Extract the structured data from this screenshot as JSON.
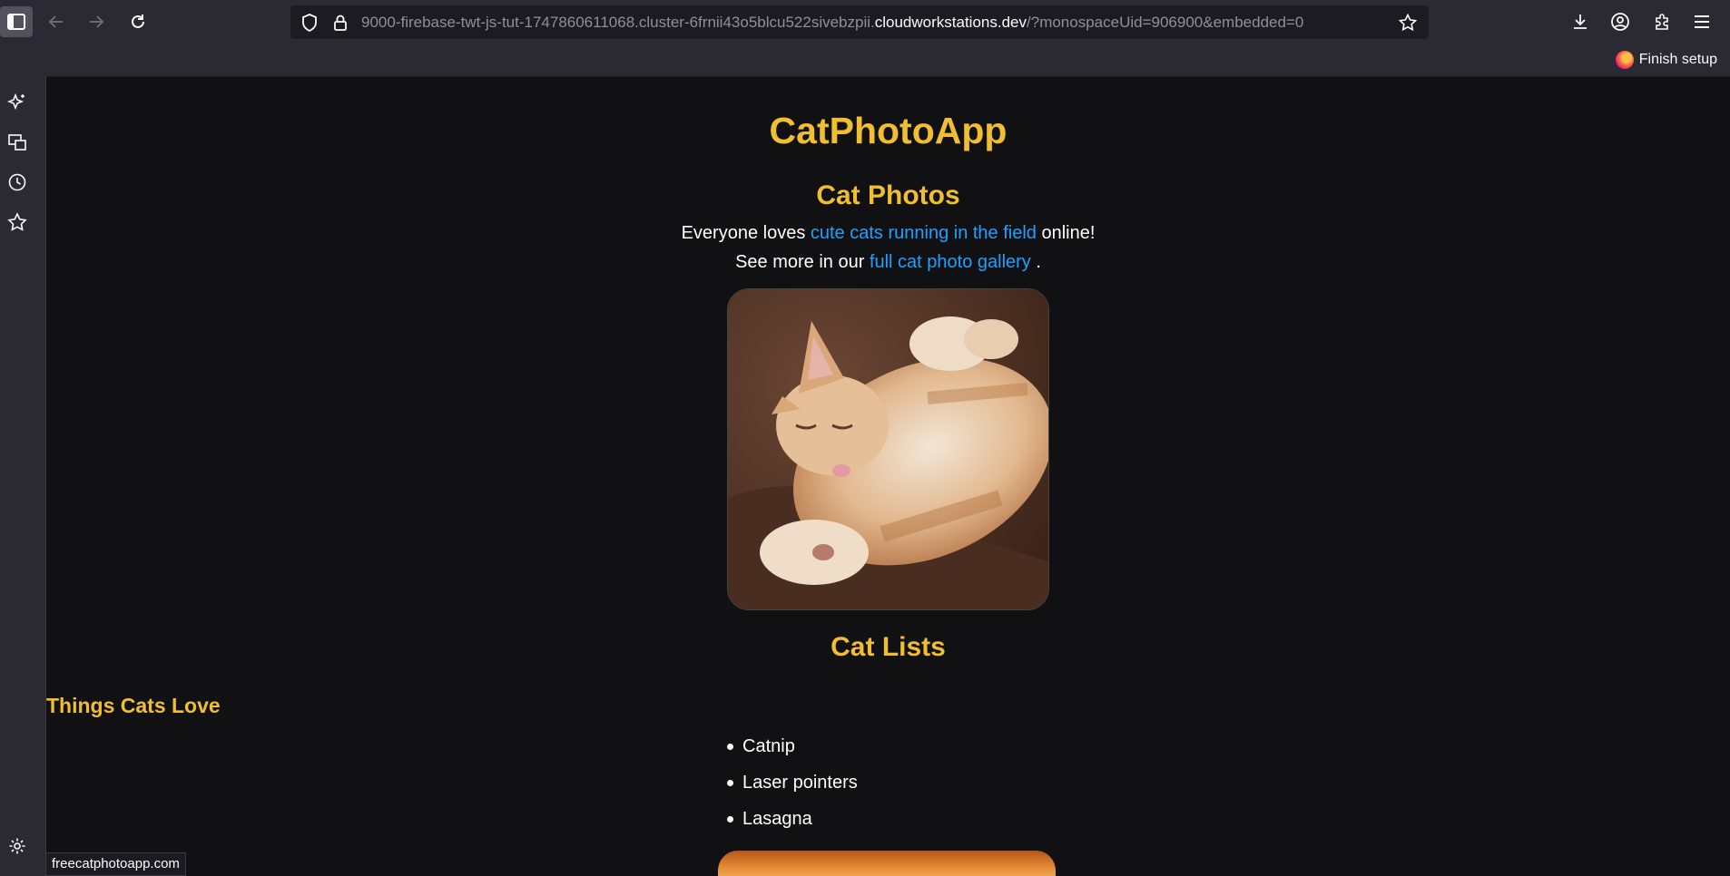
{
  "browser": {
    "url_prefix": "9000-firebase-twt-js-tut-1747860611068.cluster-6frnii43o5blcu522sivebzpii.",
    "url_host": "cloudworkstations.dev",
    "url_suffix": "/?monospaceUid=906900&embedded=0",
    "finish_setup_label": "Finish setup",
    "status_text": "freecatphotoapp.com"
  },
  "page": {
    "title": "CatPhotoApp",
    "photos_heading": "Cat Photos",
    "line1_before": "Everyone loves ",
    "line1_link": "cute cats running in the field",
    "line1_after": " online!",
    "line2_before": "See more in our ",
    "line2_link": "full cat photo gallery",
    "line2_after": " .",
    "lists_heading": "Cat Lists",
    "love_heading": "Things Cats Love",
    "love_items": [
      "Catnip",
      "Laser pointers",
      "Lasagna"
    ]
  },
  "colors": {
    "heading": "#f1be32",
    "link": "#1ea1ff",
    "page_bg": "#111113",
    "chrome_bg": "#2b2a33"
  }
}
